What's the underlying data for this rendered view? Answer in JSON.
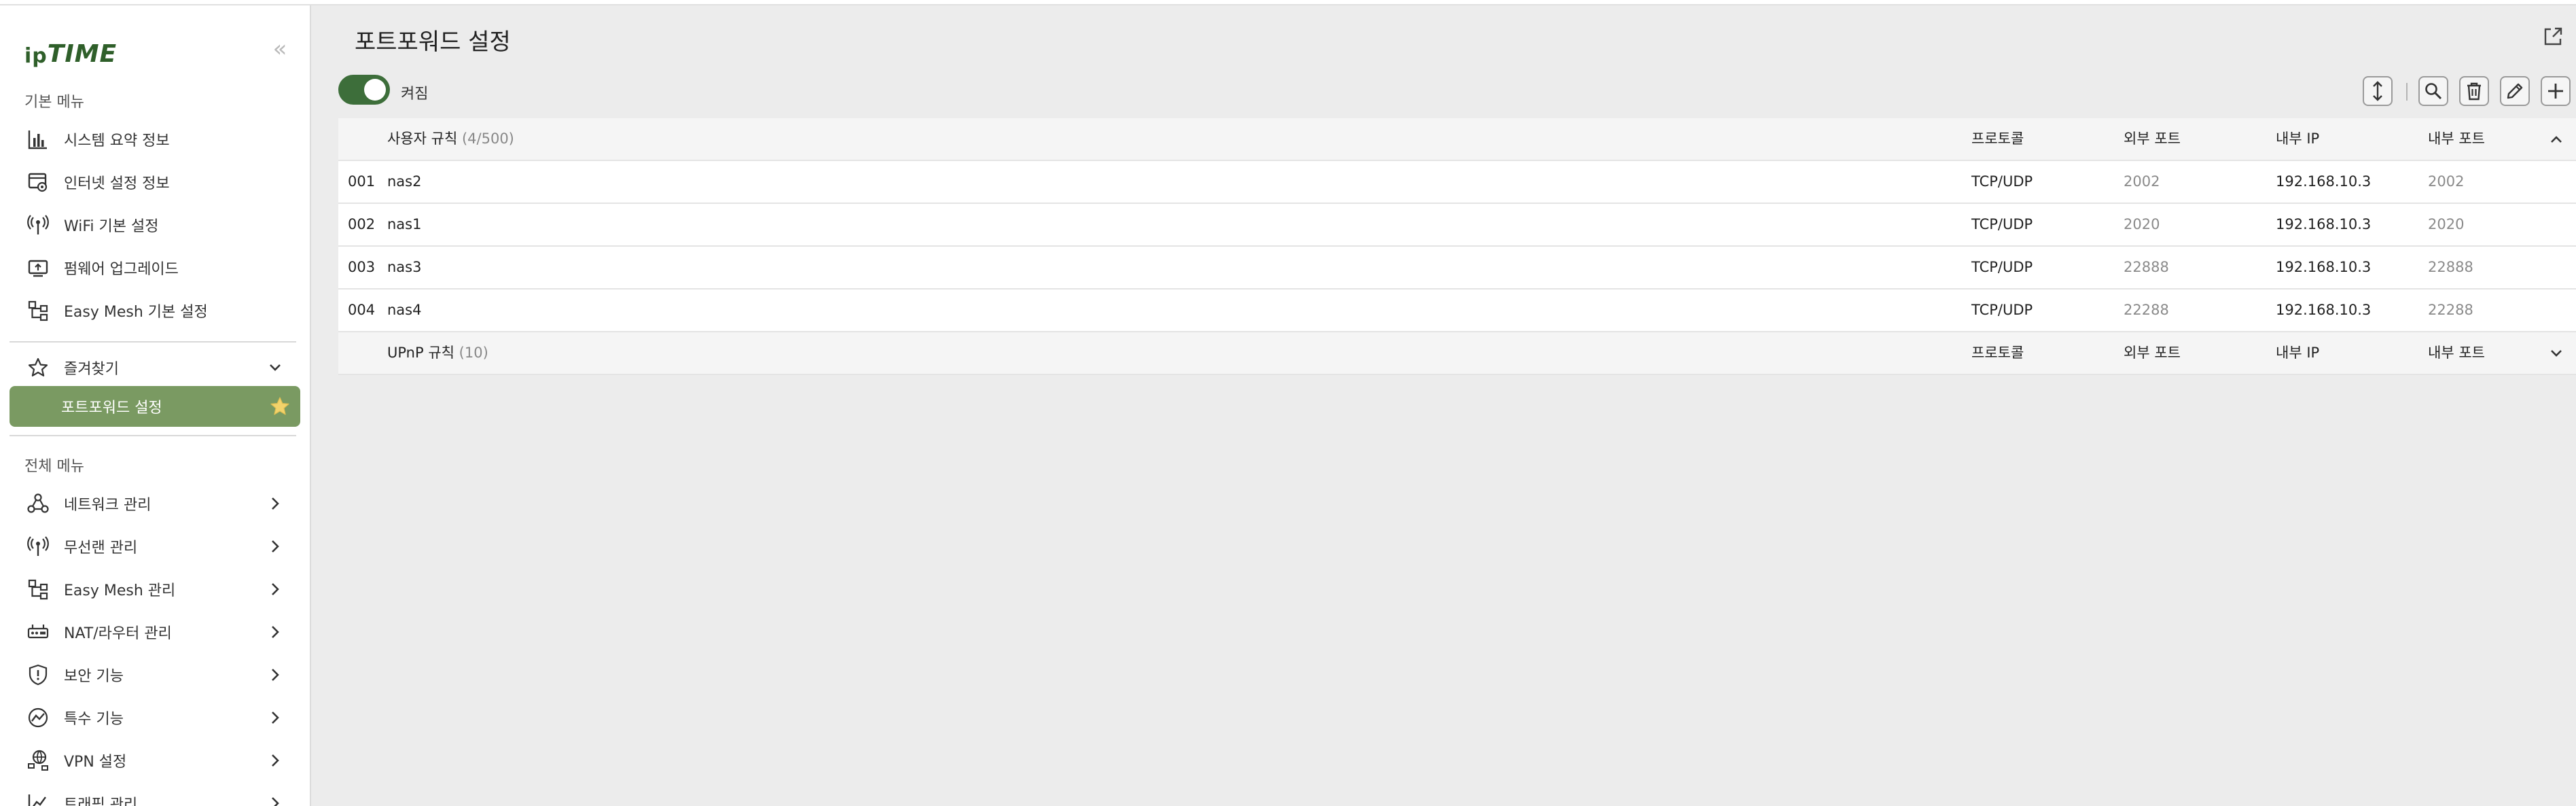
{
  "sidebar": {
    "logo": {
      "ip": "ip",
      "time": "TIME"
    },
    "collapse_glyph": "«",
    "basic_menu_label": "기본 메뉴",
    "basic_items": [
      {
        "label": "시스템 요약 정보",
        "icon": "bar-chart-icon"
      },
      {
        "label": "인터넷 설정 정보",
        "icon": "internet-settings-icon"
      },
      {
        "label": "WiFi 기본 설정",
        "icon": "wifi-antenna-icon"
      },
      {
        "label": "펌웨어 업그레이드",
        "icon": "firmware-icon"
      },
      {
        "label": "Easy Mesh 기본 설정",
        "icon": "mesh-icon"
      }
    ],
    "favorites_label": "즐겨찾기",
    "favorite_active": "포트포워드 설정",
    "all_menu_label": "전체 메뉴",
    "all_items": [
      {
        "label": "네트워크 관리",
        "icon": "network-icon"
      },
      {
        "label": "무선랜 관리",
        "icon": "wireless-icon"
      },
      {
        "label": "Easy Mesh 관리",
        "icon": "mesh-icon"
      },
      {
        "label": "NAT/라우터 관리",
        "icon": "router-icon"
      },
      {
        "label": "보안 기능",
        "icon": "shield-icon"
      },
      {
        "label": "특수 기능",
        "icon": "special-icon"
      },
      {
        "label": "VPN 설정",
        "icon": "vpn-icon"
      },
      {
        "label": "트래픽 관리",
        "icon": "traffic-icon"
      }
    ]
  },
  "main": {
    "title": "포트포워드 설정",
    "toggle": {
      "label": "켜짐",
      "on": true
    },
    "toolbar_icons": [
      "sort-icon",
      "search-icon",
      "trash-icon",
      "edit-icon",
      "add-icon"
    ]
  },
  "table": {
    "user_rules": {
      "title": "사용자 규칙",
      "count": "(4/500)",
      "columns": {
        "protocol": "프로토콜",
        "external_port": "외부 포트",
        "internal_ip": "내부 IP",
        "internal_port": "내부 포트"
      },
      "rows": [
        {
          "idx": "001",
          "name": "nas2",
          "protocol": "TCP/UDP",
          "external_port": "2002",
          "internal_ip": "192.168.10.3",
          "internal_port": "2002"
        },
        {
          "idx": "002",
          "name": "nas1",
          "protocol": "TCP/UDP",
          "external_port": "2020",
          "internal_ip": "192.168.10.3",
          "internal_port": "2020"
        },
        {
          "idx": "003",
          "name": "nas3",
          "protocol": "TCP/UDP",
          "external_port": "22888",
          "internal_ip": "192.168.10.3",
          "internal_port": "22888"
        },
        {
          "idx": "004",
          "name": "nas4",
          "protocol": "TCP/UDP",
          "external_port": "22288",
          "internal_ip": "192.168.10.3",
          "internal_port": "22288"
        }
      ]
    },
    "upnp_rules": {
      "title": "UPnP 규칙",
      "count": "(10)",
      "columns": {
        "protocol": "프로토콜",
        "external_port": "외부 포트",
        "internal_ip": "내부 IP",
        "internal_port": "내부 포트"
      }
    }
  },
  "colors": {
    "brand": "#2f5f2a",
    "active_item": "#7a9a62",
    "toggle_on": "#3d6e3a",
    "star": "#f2d36b"
  }
}
